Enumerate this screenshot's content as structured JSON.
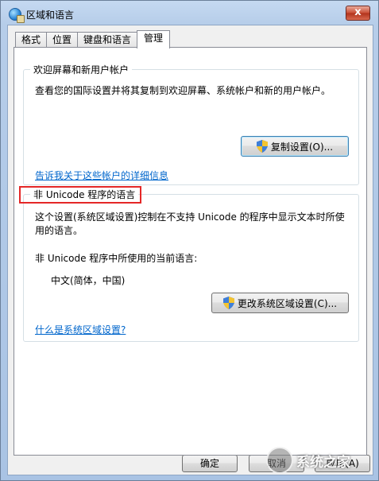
{
  "window": {
    "title": "区域和语言",
    "close_glyph": "x"
  },
  "tabs": [
    {
      "label": "格式",
      "active": false
    },
    {
      "label": "位置",
      "active": false
    },
    {
      "label": "键盘和语言",
      "active": false
    },
    {
      "label": "管理",
      "active": true
    }
  ],
  "welcome_group": {
    "legend": "欢迎屏幕和新用户帐户",
    "description": "查看您的国际设置并将其复制到欢迎屏幕、系统帐户和新的用户帐户。",
    "copy_button": "复制设置(O)...",
    "link": "告诉我关于这些帐户的详细信息"
  },
  "unicode_group": {
    "legend": "非 Unicode 程序的语言",
    "description_line1": "这个设置(系统区域设置)控制在不支持 Unicode 的程序中显示文本时所使",
    "description_line2": "用的语言。",
    "current_label": "非 Unicode 程序中所使用的当前语言:",
    "current_value": "中文(简体，中国)",
    "change_button": "更改系统区域设置(C)...",
    "link": "什么是系统区域设置?"
  },
  "footer": {
    "ok": "确定",
    "cancel": "取消",
    "apply": "应用(A)"
  },
  "watermark": {
    "text": "系统之家"
  },
  "colors": {
    "highlight_border": "#e42727",
    "link": "#0066cc",
    "title_bar": "#b6cde9"
  }
}
